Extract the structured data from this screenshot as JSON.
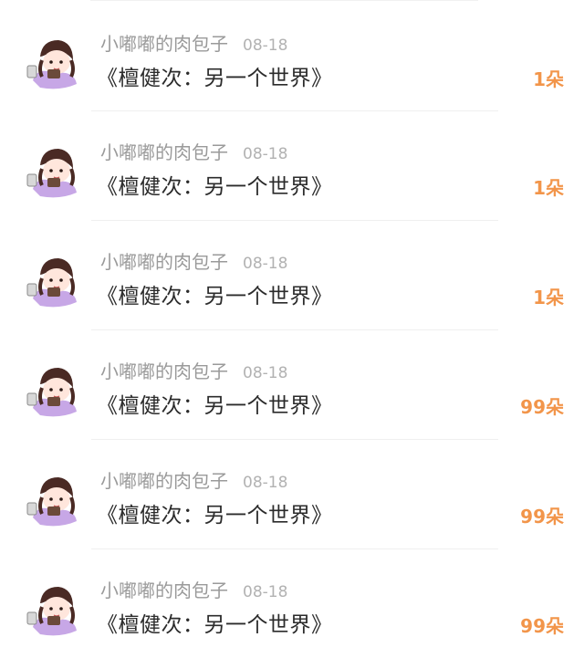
{
  "colors": {
    "author": "#9a9a9a",
    "date": "#b2b2b2",
    "title": "#2b2b2b",
    "count": "#f2954a",
    "avatar_hair": "#4a2a24",
    "avatar_dress": "#c7a7e6"
  },
  "items": [
    {
      "author": "小嘟嘟的肉包子",
      "date": "08-18",
      "title": "《檀健次：另一个世界》",
      "count": "1朵",
      "avatar_icon": "cartoon-girl-avatar"
    },
    {
      "author": "小嘟嘟的肉包子",
      "date": "08-18",
      "title": "《檀健次：另一个世界》",
      "count": "1朵",
      "avatar_icon": "cartoon-girl-avatar"
    },
    {
      "author": "小嘟嘟的肉包子",
      "date": "08-18",
      "title": "《檀健次：另一个世界》",
      "count": "1朵",
      "avatar_icon": "cartoon-girl-avatar"
    },
    {
      "author": "小嘟嘟的肉包子",
      "date": "08-18",
      "title": "《檀健次：另一个世界》",
      "count": "99朵",
      "avatar_icon": "cartoon-girl-avatar"
    },
    {
      "author": "小嘟嘟的肉包子",
      "date": "08-18",
      "title": "《檀健次：另一个世界》",
      "count": "99朵",
      "avatar_icon": "cartoon-girl-avatar"
    },
    {
      "author": "小嘟嘟的肉包子",
      "date": "08-18",
      "title": "《檀健次：另一个世界》",
      "count": "99朵",
      "avatar_icon": "cartoon-girl-avatar"
    }
  ]
}
